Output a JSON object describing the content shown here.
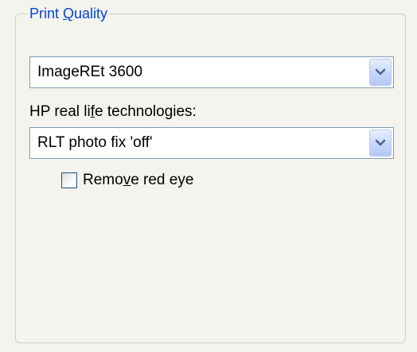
{
  "group": {
    "title_prefix": "Print ",
    "title_mnemonic": "Q",
    "title_suffix": "uality"
  },
  "quality_select": {
    "selected": "ImageREt 3600",
    "icon": "chevron-down-icon"
  },
  "hp_rlt": {
    "label_prefix": "HP real li",
    "label_mnemonic": "f",
    "label_suffix": "e technologies:",
    "selected": "RLT photo fix 'off'",
    "icon": "chevron-down-icon"
  },
  "red_eye": {
    "label_prefix": "Remo",
    "label_mnemonic": "v",
    "label_suffix": "e red eye",
    "checked": false
  },
  "colors": {
    "group_title": "#0046d5",
    "field_border": "#7f9db9",
    "background": "#f4f3ee"
  }
}
